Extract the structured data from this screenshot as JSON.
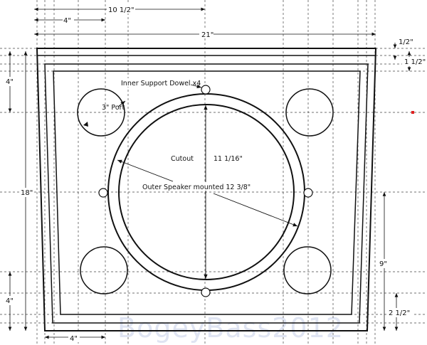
{
  "drawing": {
    "dimensions": {
      "top_half_width": "10 1/2\"",
      "top_left_offset": "4\"",
      "overall_width": "21\"",
      "right_top_small": "1/2\"",
      "right_top_large": "1 1/2\"",
      "left_top": "4\"",
      "left_height": "18\"",
      "left_bottom": "4\"",
      "bottom_left": "4\"",
      "right_lower": "9\"",
      "right_bottom": "2 1/2\""
    },
    "annotations": {
      "dowel": "Inner Support Dowel x4",
      "port": "3\" Port",
      "cutout": "Cutout",
      "cutout_size": "11 1/16\"",
      "outer_speaker": "Outer Speaker mounted 12 3/8\""
    },
    "watermark": "BogeyBass2012",
    "marker_color": "#e02020"
  }
}
